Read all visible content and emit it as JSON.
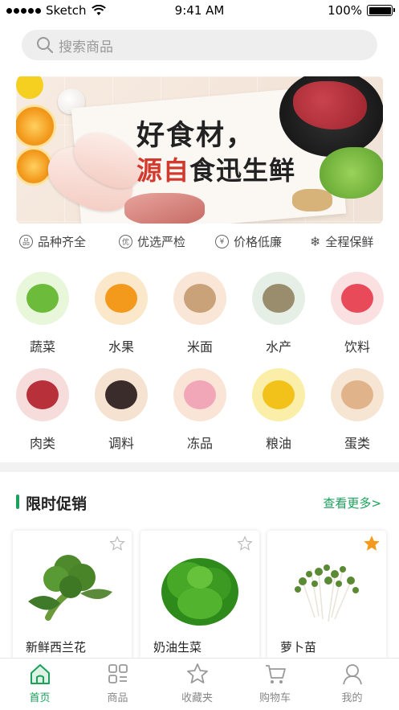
{
  "status_bar": {
    "carrier": "Sketch",
    "time": "9:41 AM",
    "battery": "100%"
  },
  "search": {
    "placeholder": "搜索商品"
  },
  "banner": {
    "line1": "好食材，",
    "line2_red": "源自",
    "line2_rest": "食迅生鲜"
  },
  "features": [
    {
      "icon": "quality-icon",
      "glyph": "品",
      "label": "品种齐全"
    },
    {
      "icon": "select-icon",
      "glyph": "优",
      "label": "优选严检"
    },
    {
      "icon": "yen-icon",
      "glyph": "¥",
      "label": "价格低廉"
    },
    {
      "icon": "snowflake-icon",
      "glyph": "❄",
      "label": "全程保鲜"
    }
  ],
  "categories": [
    {
      "label": "蔬菜",
      "bg": "#e8f6da",
      "item": "#6dbb3b"
    },
    {
      "label": "水果",
      "bg": "#fbe7c9",
      "item": "#f39a1c"
    },
    {
      "label": "米面",
      "bg": "#fae6d6",
      "item": "#c9a27a"
    },
    {
      "label": "水产",
      "bg": "#e6efe6",
      "item": "#9a8d6d"
    },
    {
      "label": "饮料",
      "bg": "#fbe0e2",
      "item": "#e84a5a"
    },
    {
      "label": "肉类",
      "bg": "#f7dcdc",
      "item": "#b8303a"
    },
    {
      "label": "调料",
      "bg": "#f6e2d0",
      "item": "#3a2c2a"
    },
    {
      "label": "冻品",
      "bg": "#f9e4d6",
      "item": "#f2a7b8"
    },
    {
      "label": "粮油",
      "bg": "#fbeea8",
      "item": "#f2c21b"
    },
    {
      "label": "蛋类",
      "bg": "#f6e5d3",
      "item": "#e0b38a"
    }
  ],
  "promo": {
    "title": "限时促销",
    "more": "查看更多>"
  },
  "products": [
    {
      "name": "新鲜西兰花",
      "favorited": false,
      "color": "#4e8a2c"
    },
    {
      "name": "奶油生菜",
      "favorited": false,
      "color": "#3d9a24"
    },
    {
      "name": "萝卜苗",
      "favorited": true,
      "color": "#6a8a3a"
    }
  ],
  "tabs": [
    {
      "label": "首页",
      "icon": "home-icon",
      "active": true
    },
    {
      "label": "商品",
      "icon": "grid-icon",
      "active": false
    },
    {
      "label": "收藏夹",
      "icon": "star-icon",
      "active": false
    },
    {
      "label": "购物车",
      "icon": "cart-icon",
      "active": false
    },
    {
      "label": "我的",
      "icon": "user-icon",
      "active": false
    }
  ],
  "colors": {
    "accent": "#1aa15a",
    "favorite": "#f39a1c",
    "banner_red": "#d23a2e"
  }
}
